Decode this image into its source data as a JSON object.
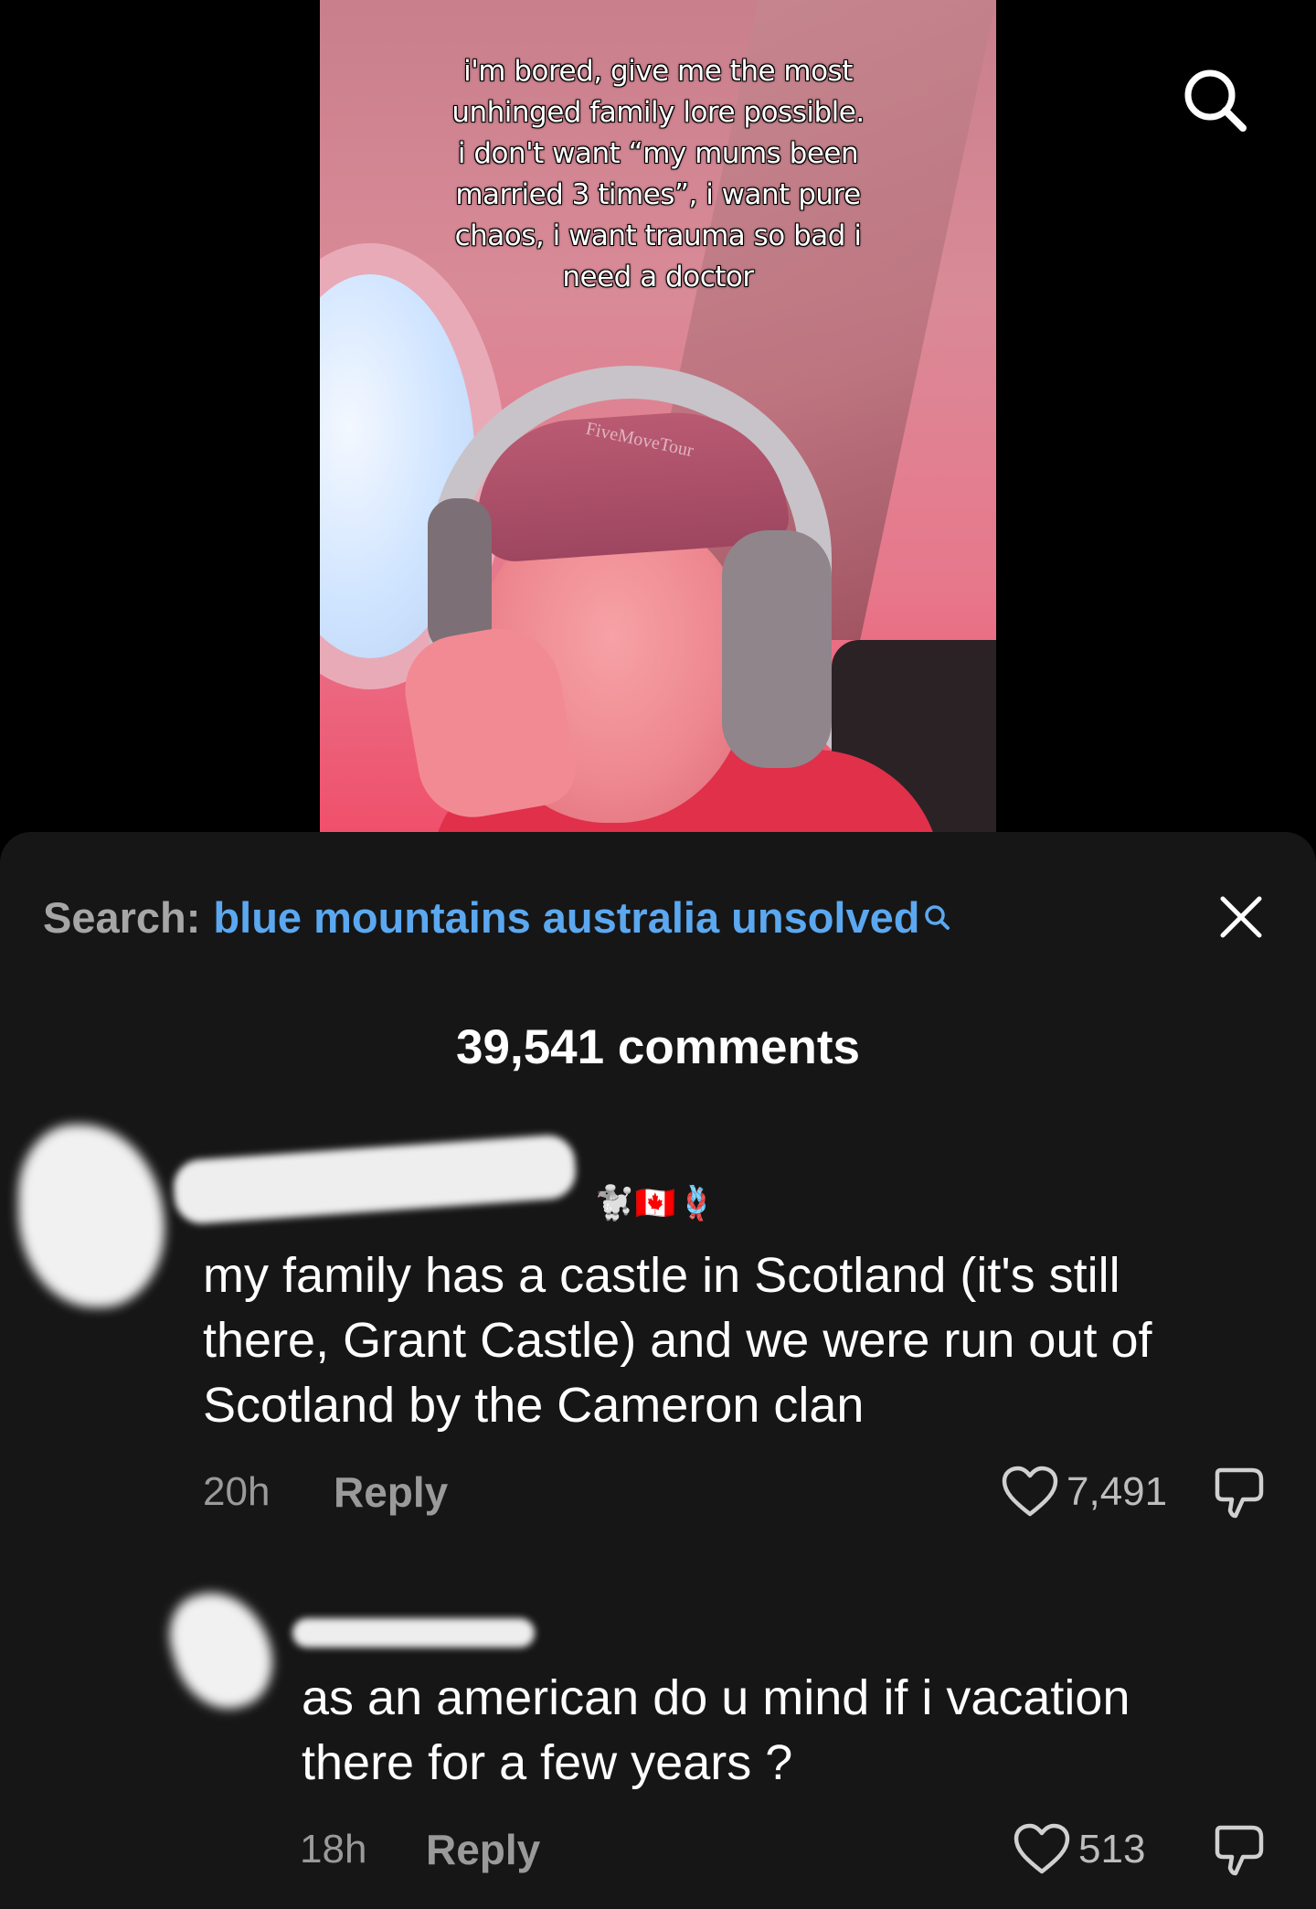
{
  "video": {
    "caption_lines": [
      "i'm bored, give me the most",
      "unhinged family lore possible.",
      "i don't want “my mums been",
      "married 3 times”, i want pure",
      "chaos, i want trauma so bad i",
      "need a doctor"
    ],
    "cap_print": "FiveMoveTour",
    "top_icon": "search-icon"
  },
  "sheet": {
    "search_label": "Search:",
    "search_term": "blue mountains australia unsolved",
    "search_icon": "search-icon",
    "close_icon": "close-icon",
    "count_text": "39,541 comments"
  },
  "comments": [
    {
      "username_redacted": true,
      "name_emojis": "🐩🇨🇦🪢",
      "text_lines": [
        "my family has a castle in Scotland (it's still",
        "there, Grant Castle) and we were run out of",
        "Scotland by the Cameron clan"
      ],
      "time": "20h",
      "reply_label": "Reply",
      "likes": "7,491"
    },
    {
      "username_redacted": true,
      "text_lines": [
        "as an american do u mind if i vacation",
        "there for a few years ?"
      ],
      "time": "18h",
      "reply_label": "Reply",
      "likes": "513"
    }
  ],
  "colors": {
    "sheet_bg": "#161616",
    "link_blue": "#5ba8f0",
    "muted_gray": "#9a9a9a"
  }
}
